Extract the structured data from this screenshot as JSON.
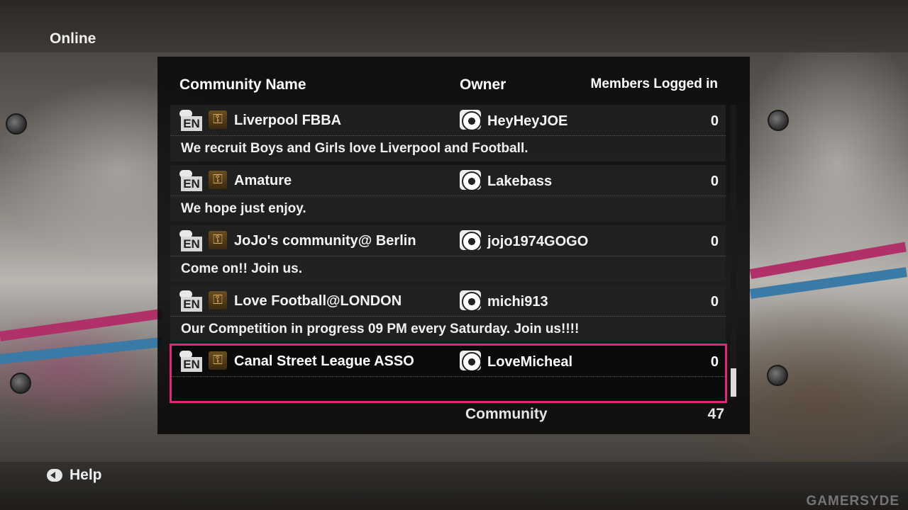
{
  "window": {
    "title": "Online"
  },
  "table": {
    "headers": {
      "community_name": "Community Name",
      "owner": "Owner",
      "members_logged_in": "Members Logged in"
    },
    "rows": [
      {
        "language": "EN",
        "name": "Liverpool FBBA",
        "owner": "HeyHeyJOE",
        "members": "0",
        "description": "We recruit Boys and Girls love Liverpool and Football."
      },
      {
        "language": "EN",
        "name": "Amature",
        "owner": "Lakebass",
        "members": "0",
        "description": "We hope just enjoy."
      },
      {
        "language": "EN",
        "name": "JoJo's community@ Berlin",
        "owner": "jojo1974GOGO",
        "members": "0",
        "description": "Come on!! Join us."
      },
      {
        "language": "EN",
        "name": "Love Football@LONDON",
        "owner": "michi913",
        "members": "0",
        "description": "Our Competition in progress 09 PM every Saturday. Join us!!!!"
      },
      {
        "language": "EN",
        "name": "Canal Street League ASSO",
        "owner": "LoveMicheal",
        "members": "0",
        "description": ""
      }
    ],
    "selected_row": 4,
    "icons": {
      "language": "speech-bubble-en-icon",
      "private": "key-icon",
      "owner": "football-icon"
    },
    "footer": {
      "label": "Community",
      "count": "47"
    }
  },
  "bottom_bar": {
    "help_label": "Help",
    "help_icon": "circle-button-icon"
  },
  "watermark": "GAMERSYDE",
  "colors": {
    "highlight": "#e0287a",
    "panel": "#080808"
  }
}
